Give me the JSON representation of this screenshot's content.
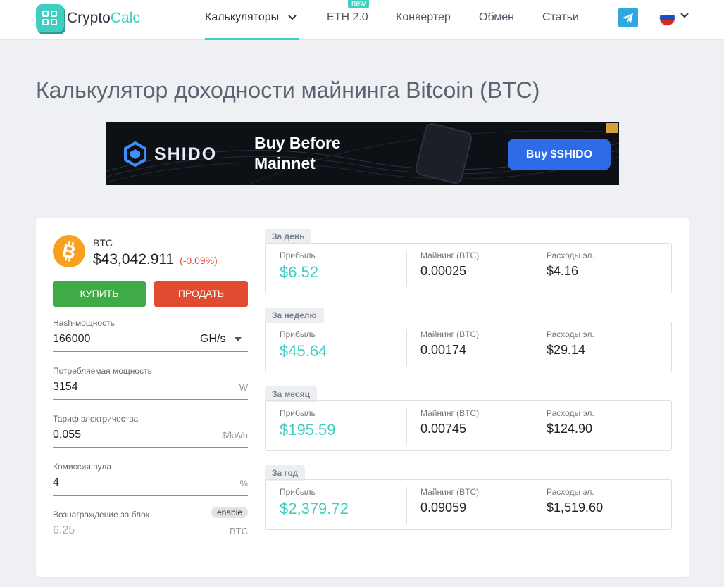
{
  "header": {
    "logo_prefix": "Crypto",
    "logo_suffix": "Calc",
    "nav": [
      {
        "label": "Калькуляторы"
      },
      {
        "label": "ETH 2.0",
        "badge": "new"
      },
      {
        "label": "Конвертер"
      },
      {
        "label": "Обмен"
      },
      {
        "label": "Статьи"
      }
    ]
  },
  "page_title": "Калькулятор доходности майнинга Bitcoin (BTC)",
  "banner": {
    "brand": "SHIDO",
    "headline": "Buy Before Mainnet",
    "cta": "Buy $SHIDO"
  },
  "coin": {
    "symbol": "BTC",
    "price": "$43,042.911",
    "change": "(-0.09%)"
  },
  "actions": {
    "buy": "КУПИТЬ",
    "sell": "ПРОДАТЬ"
  },
  "fields": {
    "hashrate": {
      "label": "Hash-мощность",
      "value": "166000",
      "unit": "GH/s"
    },
    "power": {
      "label": "Потребляемая мощность",
      "value": "3154",
      "unit": "W"
    },
    "tariff": {
      "label": "Тариф электричества",
      "value": "0.055",
      "unit": "$/kWh"
    },
    "pool_fee": {
      "label": "Комиссия пула",
      "value": "4",
      "unit": "%"
    },
    "block_reward": {
      "label": "Вознаграждение за блок",
      "value": "6.25",
      "unit": "BTC",
      "toggle": "enable"
    }
  },
  "column_labels": {
    "profit": "Прибыль",
    "mined": "Майнинг (BTC)",
    "cost": "Расходы эл."
  },
  "periods": [
    {
      "name": "За день",
      "profit": "$6.52",
      "mined": "0.00025",
      "cost": "$4.16"
    },
    {
      "name": "За неделю",
      "profit": "$45.64",
      "mined": "0.00174",
      "cost": "$29.14"
    },
    {
      "name": "За месяц",
      "profit": "$195.59",
      "mined": "0.00745",
      "cost": "$124.90"
    },
    {
      "name": "За год",
      "profit": "$2,379.72",
      "mined": "0.09059",
      "cost": "$1,519.60"
    }
  ]
}
